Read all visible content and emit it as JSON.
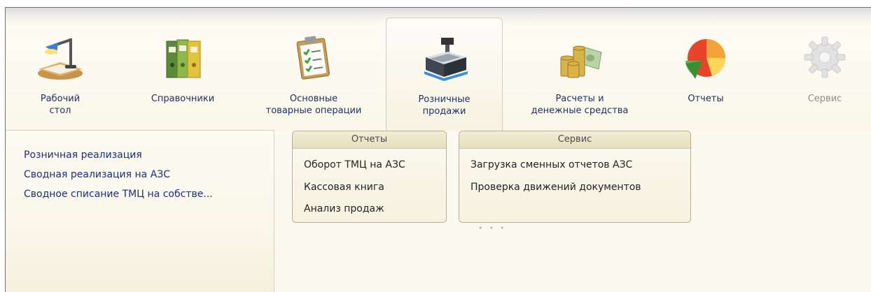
{
  "sections": [
    {
      "label": "Рабочий\nстол",
      "icon": "desk-lamp-icon"
    },
    {
      "label": "Справочники",
      "icon": "binders-icon"
    },
    {
      "label": "Основные\nтоварные операции",
      "icon": "clipboard-checklist-icon"
    },
    {
      "label": "Розничные\nпродажи",
      "icon": "cash-register-icon"
    },
    {
      "label": "Расчеты и\nденежные средства",
      "icon": "coins-money-icon"
    },
    {
      "label": "Отчеты",
      "icon": "pie-chart-icon"
    },
    {
      "label": "Сервис",
      "icon": "gear-icon"
    }
  ],
  "active_section": "Розничные продажи",
  "panel_items": [
    "Розничная реализация",
    "Сводная реализация на АЗС",
    "Сводное списание ТМЦ на собстве..."
  ],
  "groups": [
    {
      "title": "Отчеты",
      "items": [
        "Оборот ТМЦ на АЗС",
        "Кассовая книга",
        "Анализ продаж"
      ]
    },
    {
      "title": "Сервис",
      "items": [
        "Загрузка сменных отчетов АЗС",
        "Проверка движений документов"
      ]
    }
  ],
  "colors": {
    "link": "#1b2d86",
    "section_label": "#1f2f6a",
    "disabled": "#8c8c8c"
  }
}
